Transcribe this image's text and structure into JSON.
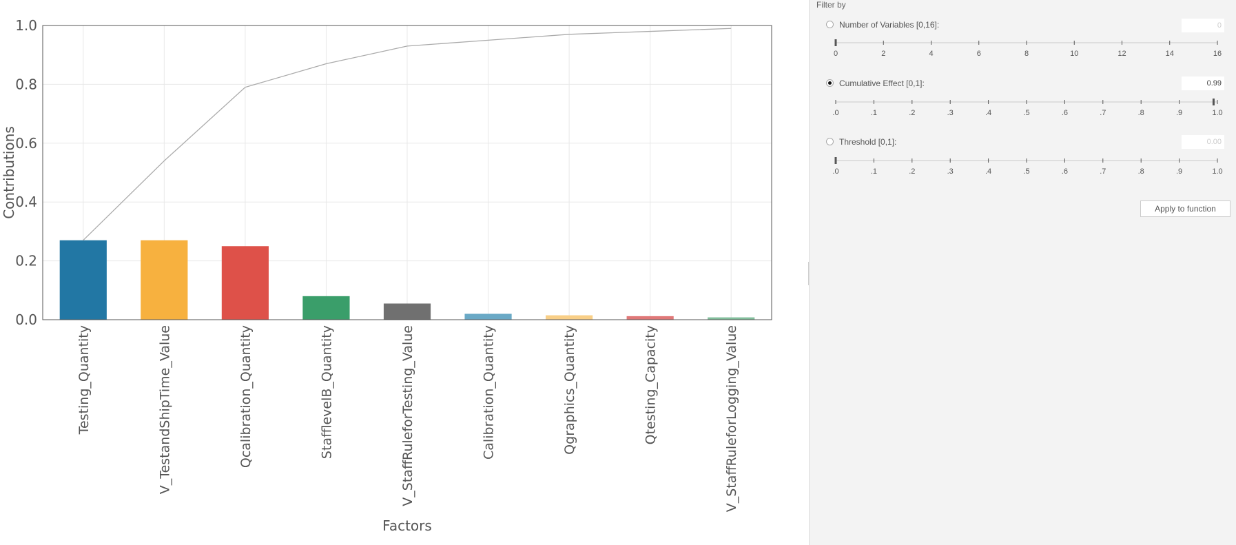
{
  "chart_data": {
    "type": "bar",
    "xlabel": "Factors",
    "ylabel": "Contributions",
    "ylim": [
      0,
      1.0
    ],
    "yticks": [
      "0.0",
      "0.2",
      "0.4",
      "0.6",
      "0.8",
      "1.0"
    ],
    "grid": true,
    "categories": [
      "Testing_Quantity",
      "V_TestandShipTime_Value",
      "Qcalibration_Quantity",
      "StafflevelB_Quantity",
      "V_StaffRuleforTesting_Value",
      "Calibration_Quantity",
      "Qgraphics_Quantity",
      "Qtesting_Capacity",
      "V_StaffRuleforLogging_Value"
    ],
    "values": [
      0.27,
      0.27,
      0.25,
      0.08,
      0.055,
      0.02,
      0.015,
      0.012,
      0.008
    ],
    "bar_colors": [
      "#2277a4",
      "#f7b13f",
      "#de5149",
      "#3a9e6a",
      "#707070",
      "#6aa9c6",
      "#f9cf87",
      "#e07878",
      "#82bf9c"
    ],
    "cumulative_line": {
      "values": [
        0.27,
        0.54,
        0.79,
        0.87,
        0.93,
        0.95,
        0.97,
        0.98,
        0.99
      ],
      "color": "#aaaaaa"
    }
  },
  "filter_panel": {
    "title": "Filter by",
    "number_of_variables": {
      "label": "Number of Variables [0,16]:",
      "value": "0",
      "checked": false,
      "ticks": [
        "0",
        "2",
        "4",
        "6",
        "8",
        "10",
        "12",
        "14",
        "16"
      ]
    },
    "cumulative_effect": {
      "label": "Cumulative Effect [0,1]:",
      "value": "0.99",
      "checked": true,
      "ticks": [
        ".0",
        ".1",
        ".2",
        ".3",
        ".4",
        ".5",
        ".6",
        ".7",
        ".8",
        ".9",
        "1.0"
      ]
    },
    "threshold": {
      "label": "Threshold [0,1]:",
      "value": "0.00",
      "checked": false,
      "ticks": [
        ".0",
        ".1",
        ".2",
        ".3",
        ".4",
        ".5",
        ".6",
        ".7",
        ".8",
        ".9",
        "1.0"
      ]
    },
    "apply_label": "Apply to function"
  }
}
